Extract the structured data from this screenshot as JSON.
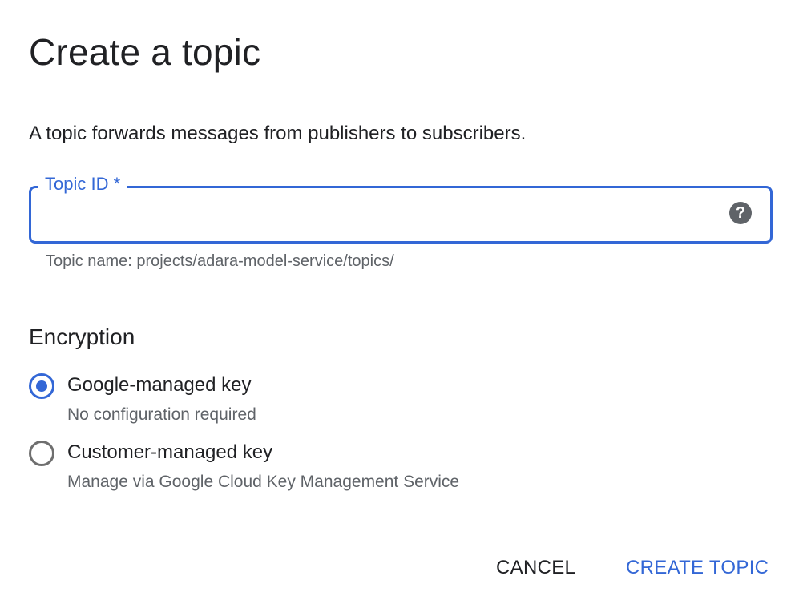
{
  "dialog": {
    "title": "Create a topic",
    "description": "A topic forwards messages from publishers to subscribers."
  },
  "topic_id_field": {
    "label": "Topic ID *",
    "value": "",
    "placeholder": "",
    "help_icon": "help-circle-icon",
    "hint": "Topic name: projects/adara-model-service/topics/"
  },
  "encryption": {
    "heading": "Encryption",
    "options": [
      {
        "label": "Google-managed key",
        "description": "No configuration required",
        "selected": true
      },
      {
        "label": "Customer-managed key",
        "description": "Manage via Google Cloud Key Management Service",
        "selected": false
      }
    ]
  },
  "actions": {
    "cancel_label": "CANCEL",
    "create_label": "CREATE TOPIC"
  },
  "colors": {
    "accent": "#3367d6",
    "text_primary": "#202124",
    "text_secondary": "#5f6368",
    "radio_unchecked": "#6f6f6f"
  }
}
